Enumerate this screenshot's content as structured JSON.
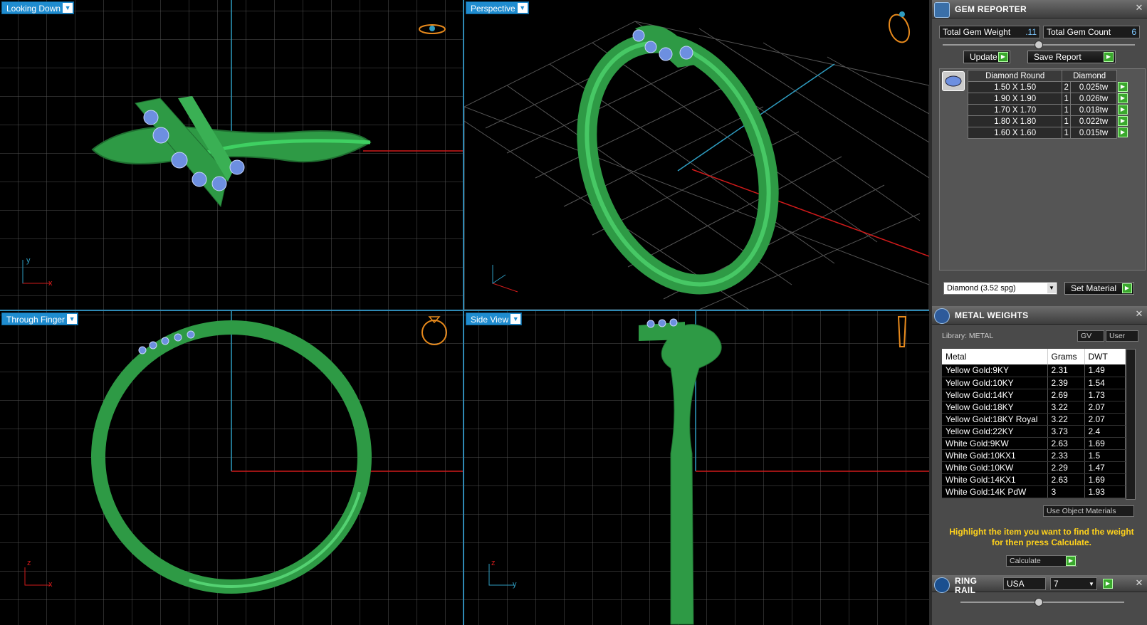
{
  "viewports": {
    "top_left": {
      "label": "Looking Down"
    },
    "top_right": {
      "label": "Perspective"
    },
    "bottom_left": {
      "label": "Through Finger"
    },
    "bottom_right": {
      "label": "Side View"
    }
  },
  "axes": {
    "x": "x",
    "y": "y",
    "z": "z"
  },
  "gem_reporter": {
    "title": "GEM REPORTER",
    "total_weight_label": "Total Gem Weight",
    "total_weight_value": ".11",
    "total_count_label": "Total Gem Count",
    "total_count_value": "6",
    "update_label": "Update",
    "save_report_label": "Save Report",
    "table_headers": [
      "Diamond Round",
      "Diamond"
    ],
    "rows": [
      {
        "size": "1.50 X 1.50",
        "count": "2",
        "tw": "0.025tw"
      },
      {
        "size": "1.90 X 1.90",
        "count": "1",
        "tw": "0.026tw"
      },
      {
        "size": "1.70 X 1.70",
        "count": "1",
        "tw": "0.018tw"
      },
      {
        "size": "1.80 X 1.80",
        "count": "1",
        "tw": "0.022tw"
      },
      {
        "size": "1.60 X 1.60",
        "count": "1",
        "tw": "0.015tw"
      }
    ],
    "material_select": "Diamond    (3.52 spg)",
    "set_material_label": "Set Material"
  },
  "metal_weights": {
    "title": "METAL WEIGHTS",
    "library_label": "Library: METAL",
    "gv_label": "GV",
    "user_label": "User",
    "headers": [
      "Metal",
      "Grams",
      "DWT"
    ],
    "rows": [
      {
        "metal": "Yellow Gold:9KY",
        "grams": "2.31",
        "dwt": "1.49"
      },
      {
        "metal": "Yellow Gold:10KY",
        "grams": "2.39",
        "dwt": "1.54"
      },
      {
        "metal": "Yellow Gold:14KY",
        "grams": "2.69",
        "dwt": "1.73"
      },
      {
        "metal": "Yellow Gold:18KY",
        "grams": "3.22",
        "dwt": "2.07"
      },
      {
        "metal": "Yellow Gold:18KY Royal",
        "grams": "3.22",
        "dwt": "2.07"
      },
      {
        "metal": "Yellow Gold:22KY",
        "grams": "3.73",
        "dwt": "2.4"
      },
      {
        "metal": "White Gold:9KW",
        "grams": "2.63",
        "dwt": "1.69"
      },
      {
        "metal": "White Gold:10KX1",
        "grams": "2.33",
        "dwt": "1.5"
      },
      {
        "metal": "White Gold:10KW",
        "grams": "2.29",
        "dwt": "1.47"
      },
      {
        "metal": "White Gold:14KX1",
        "grams": "2.63",
        "dwt": "1.69"
      },
      {
        "metal": "White Gold:14K PdW",
        "grams": "3",
        "dwt": "1.93"
      }
    ],
    "use_object_materials": "Use Object Materials",
    "note": "Highlight the item you want to find the weight for then press Calculate.",
    "calculate_label": "Calculate"
  },
  "ring_rail": {
    "title": "RING RAIL",
    "region": "USA",
    "size": "7"
  },
  "colors": {
    "ring": "#2e9a45",
    "gem": "#6d8fe0",
    "grid": "#5a5a5a",
    "accent": "#1f8ccf"
  }
}
